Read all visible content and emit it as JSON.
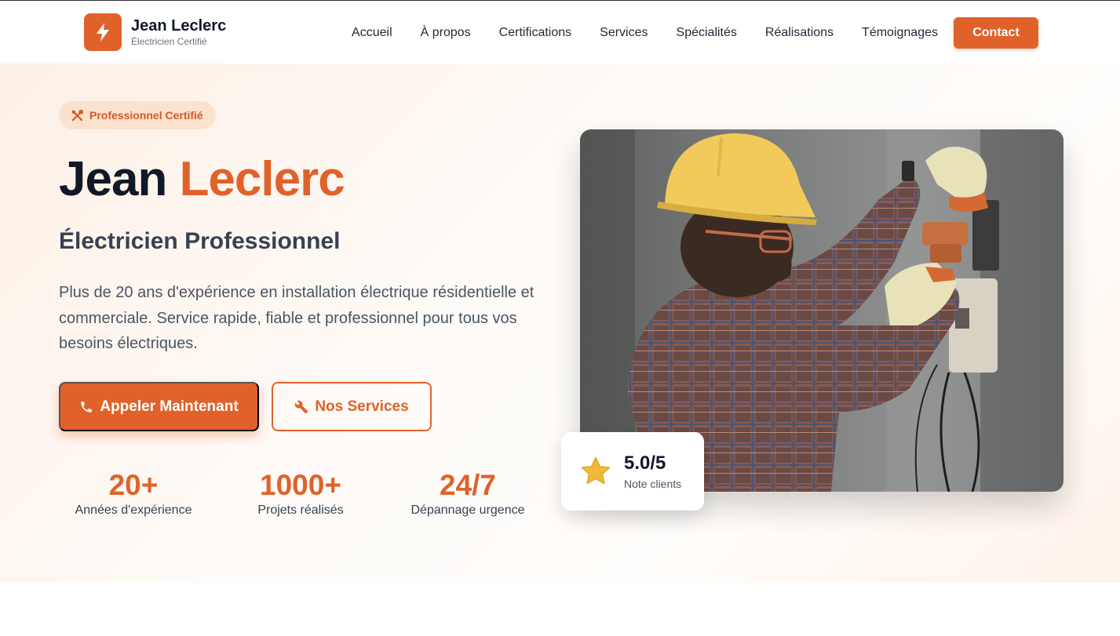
{
  "brand": {
    "name": "Jean Leclerc",
    "tagline": "Électricien Certifié",
    "logo_icon": "lightning-bolt-icon"
  },
  "nav": {
    "links": [
      "Accueil",
      "À propos",
      "Certifications",
      "Services",
      "Spécialités",
      "Réalisations",
      "Témoignages"
    ],
    "contact_label": "Contact"
  },
  "hero": {
    "badge": "Professionnel Certifié",
    "badge_icon": "tools-icon",
    "title_first": "Jean",
    "title_accent": "Leclerc",
    "subtitle": "Électricien Professionnel",
    "description": "Plus de 20 ans d'expérience en installation électrique résidentielle et commerciale. Service rapide, fiable et professionnel pour tous vos besoins électriques.",
    "primary_button": "Appeler Maintenant",
    "primary_icon": "phone-icon",
    "secondary_button": "Nos Services",
    "secondary_icon": "wrench-icon",
    "stats": [
      {
        "value": "20+",
        "label": "Années d'expérience"
      },
      {
        "value": "1000+",
        "label": "Projets réalisés"
      },
      {
        "value": "24/7",
        "label": "Dépannage urgence"
      }
    ],
    "rating": {
      "value": "5.0/5",
      "label": "Note clients",
      "icon": "star-icon"
    }
  },
  "colors": {
    "accent": "#e0622a",
    "badge_bg": "#fbe2cf",
    "star": "#f0b93a",
    "text_dark": "#111827"
  }
}
